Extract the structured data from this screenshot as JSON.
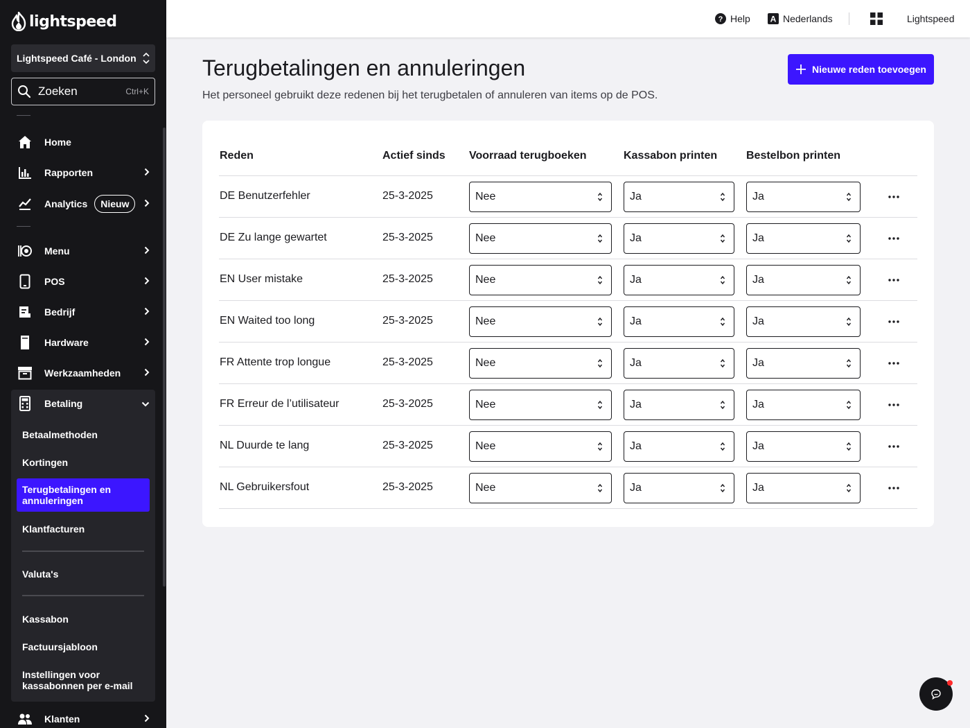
{
  "brand": {
    "name": "lightspeed",
    "accent": "#3c16ff"
  },
  "store_selector": {
    "label": "Lightspeed Café - London"
  },
  "search": {
    "label": "Zoeken",
    "shortcut": "Ctrl+K"
  },
  "nav": {
    "home": "Home",
    "rapporten": "Rapporten",
    "analytics": "Analytics",
    "analytics_badge": "Nieuw",
    "menu": "Menu",
    "pos": "POS",
    "bedrijf": "Bedrijf",
    "hardware": "Hardware",
    "werkzaamheden": "Werkzaamheden",
    "betaling": "Betaling",
    "klanten": "Klanten"
  },
  "betaling_sub": {
    "betaalmethoden": "Betaalmethoden",
    "kortingen": "Kortingen",
    "terugbetalingen": "Terugbetalingen en annuleringen",
    "klantfacturen": "Klantfacturen",
    "valutas": "Valuta's",
    "kassabon": "Kassabon",
    "factuursjabloon": "Factuursjabloon",
    "instellingen_email": "Instellingen voor kassabonnen per e-mail"
  },
  "topbar": {
    "help": "Help",
    "language": "Nederlands",
    "account": "Lightspeed"
  },
  "page": {
    "title": "Terugbetalingen en annuleringen",
    "subtitle": "Het personeel gebruikt deze redenen bij het terugbetalen of annuleren van items op de POS.",
    "add_button": "Nieuwe reden toevoegen"
  },
  "table": {
    "headers": {
      "reden": "Reden",
      "actief": "Actief sinds",
      "voorraad": "Voorraad terugboeken",
      "kassabon": "Kassabon printen",
      "bestelbon": "Bestelbon printen"
    },
    "rows": [
      {
        "reden": "DE Benutzerfehler",
        "actief": "25-3-2025",
        "voorraad": "Nee",
        "kassabon": "Ja",
        "bestelbon": "Ja"
      },
      {
        "reden": "DE Zu lange gewartet",
        "actief": "25-3-2025",
        "voorraad": "Nee",
        "kassabon": "Ja",
        "bestelbon": "Ja"
      },
      {
        "reden": "EN User mistake",
        "actief": "25-3-2025",
        "voorraad": "Nee",
        "kassabon": "Ja",
        "bestelbon": "Ja"
      },
      {
        "reden": "EN Waited too long",
        "actief": "25-3-2025",
        "voorraad": "Nee",
        "kassabon": "Ja",
        "bestelbon": "Ja"
      },
      {
        "reden": "FR Attente trop longue",
        "actief": "25-3-2025",
        "voorraad": "Nee",
        "kassabon": "Ja",
        "bestelbon": "Ja"
      },
      {
        "reden": "FR Erreur de l’utilisateur",
        "actief": "25-3-2025",
        "voorraad": "Nee",
        "kassabon": "Ja",
        "bestelbon": "Ja"
      },
      {
        "reden": "NL Duurde te lang",
        "actief": "25-3-2025",
        "voorraad": "Nee",
        "kassabon": "Ja",
        "bestelbon": "Ja"
      },
      {
        "reden": "NL Gebruikersfout",
        "actief": "25-3-2025",
        "voorraad": "Nee",
        "kassabon": "Ja",
        "bestelbon": "Ja"
      }
    ]
  }
}
